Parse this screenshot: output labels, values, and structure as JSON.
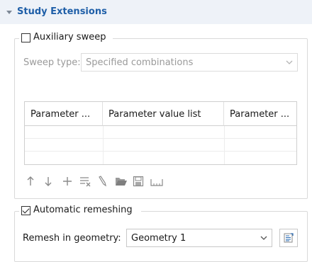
{
  "section": {
    "title": "Study Extensions"
  },
  "auxiliary_sweep": {
    "label": "Auxiliary sweep",
    "checked": false
  },
  "sweep_type": {
    "label": "Sweep type:",
    "value": "Specified combinations",
    "enabled": false
  },
  "parameter_table": {
    "columns": [
      "Parameter ...",
      "Parameter value list",
      "Parameter ..."
    ],
    "rows": [
      [],
      [],
      []
    ]
  },
  "toolbar": {
    "icons": [
      "move-up-icon",
      "move-down-icon",
      "add-icon",
      "delete-rows-icon",
      "clear-table-icon",
      "load-from-file-icon",
      "save-to-file-icon",
      "range-icon"
    ]
  },
  "automatic_remeshing": {
    "label": "Automatic remeshing",
    "checked": true
  },
  "remesh_geometry": {
    "label": "Remesh in geometry:",
    "value": "Geometry 1"
  }
}
